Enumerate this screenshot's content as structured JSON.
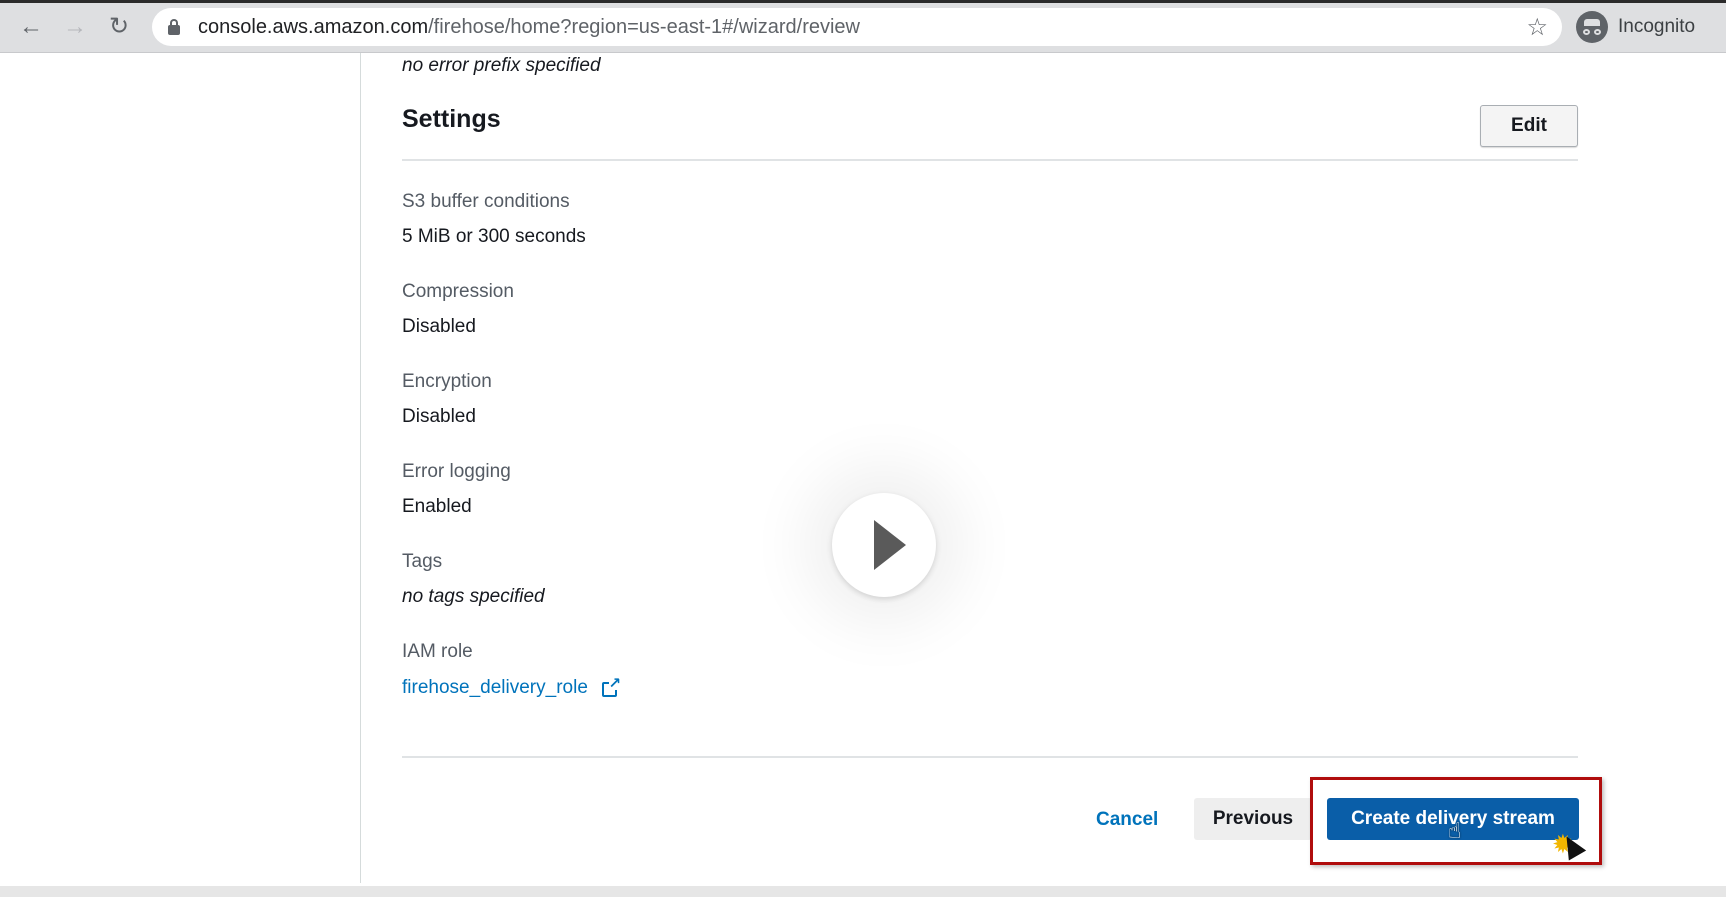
{
  "browser": {
    "url_host": "console.aws.amazon.com",
    "url_path": "/firehose/home?region=us-east-1#/wizard/review",
    "incognito_label": "Incognito",
    "icons": {
      "back": "back-arrow-icon",
      "forward": "forward-arrow-icon",
      "reload": "reload-icon",
      "lock": "lock-icon",
      "bookmark": "star-icon",
      "incognito": "incognito-icon"
    }
  },
  "content": {
    "prefix_note": "no error prefix specified",
    "section_title": "Settings",
    "edit_label": "Edit",
    "fields": [
      {
        "label": "S3 buffer conditions",
        "value": "5 MiB or 300 seconds"
      },
      {
        "label": "Compression",
        "value": "Disabled"
      },
      {
        "label": "Encryption",
        "value": "Disabled"
      },
      {
        "label": "Error logging",
        "value": "Enabled"
      },
      {
        "label": "Tags",
        "value": "no tags specified"
      },
      {
        "label": "IAM role",
        "value": "firehose_delivery_role"
      }
    ]
  },
  "footer": {
    "cancel_label": "Cancel",
    "previous_label": "Previous",
    "create_label": "Create delivery stream"
  },
  "colors": {
    "link": "#0073bb",
    "primary_button": "#0a5ea8",
    "highlight": "#b00d0d"
  }
}
